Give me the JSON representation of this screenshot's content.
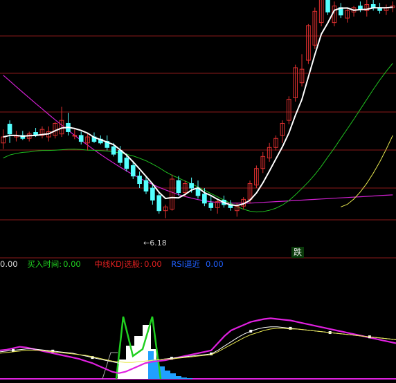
{
  "chart_data": [
    {
      "type": "candlestick",
      "title": "",
      "ylim": [
        4.8,
        8.2
      ],
      "grid": true,
      "annotation": {
        "text": "6.18",
        "arrow": "←"
      },
      "signal_label": "跌",
      "colors": {
        "up": "#e03030",
        "down": "#54ffff",
        "ma_white": "#ffffff",
        "ma_magenta": "#d020d0",
        "ma_green": "#20c020",
        "ma_yellow": "#e8e850",
        "grid": "#8b1a1a"
      },
      "candles": [
        {
          "o": 6.3,
          "h": 6.48,
          "l": 6.22,
          "c": 6.38
        },
        {
          "o": 6.55,
          "h": 6.6,
          "l": 6.3,
          "c": 6.42
        },
        {
          "o": 6.38,
          "h": 6.46,
          "l": 6.32,
          "c": 6.4
        },
        {
          "o": 6.4,
          "h": 6.46,
          "l": 6.34,
          "c": 6.36
        },
        {
          "o": 6.36,
          "h": 6.45,
          "l": 6.32,
          "c": 6.42
        },
        {
          "o": 6.44,
          "h": 6.5,
          "l": 6.38,
          "c": 6.4
        },
        {
          "o": 6.4,
          "h": 6.52,
          "l": 6.36,
          "c": 6.48
        },
        {
          "o": 6.38,
          "h": 6.52,
          "l": 6.32,
          "c": 6.45
        },
        {
          "o": 6.4,
          "h": 6.58,
          "l": 6.36,
          "c": 6.56
        },
        {
          "o": 6.42,
          "h": 6.78,
          "l": 6.38,
          "c": 6.6
        },
        {
          "o": 6.56,
          "h": 6.7,
          "l": 6.4,
          "c": 6.45
        },
        {
          "o": 6.4,
          "h": 6.48,
          "l": 6.35,
          "c": 6.4
        },
        {
          "o": 6.4,
          "h": 6.45,
          "l": 6.28,
          "c": 6.32
        },
        {
          "o": 6.3,
          "h": 6.42,
          "l": 6.2,
          "c": 6.38
        },
        {
          "o": 6.38,
          "h": 6.44,
          "l": 6.3,
          "c": 6.32
        },
        {
          "o": 6.35,
          "h": 6.4,
          "l": 6.28,
          "c": 6.3
        },
        {
          "o": 6.32,
          "h": 6.4,
          "l": 6.2,
          "c": 6.24
        },
        {
          "o": 6.25,
          "h": 6.3,
          "l": 6.12,
          "c": 6.15
        },
        {
          "o": 6.2,
          "h": 6.26,
          "l": 6.0,
          "c": 6.04
        },
        {
          "o": 6.1,
          "h": 6.16,
          "l": 5.92,
          "c": 5.96
        },
        {
          "o": 6.0,
          "h": 6.06,
          "l": 5.82,
          "c": 5.86
        },
        {
          "o": 5.86,
          "h": 5.92,
          "l": 5.7,
          "c": 5.76
        },
        {
          "o": 5.8,
          "h": 5.86,
          "l": 5.62,
          "c": 5.66
        },
        {
          "o": 5.7,
          "h": 5.76,
          "l": 5.48,
          "c": 5.54
        },
        {
          "o": 5.6,
          "h": 5.66,
          "l": 5.36,
          "c": 5.4
        },
        {
          "o": 5.4,
          "h": 5.48,
          "l": 5.3,
          "c": 5.45
        },
        {
          "o": 5.42,
          "h": 5.88,
          "l": 5.4,
          "c": 5.82
        },
        {
          "o": 5.8,
          "h": 5.86,
          "l": 5.6,
          "c": 5.64
        },
        {
          "o": 5.64,
          "h": 5.8,
          "l": 5.58,
          "c": 5.76
        },
        {
          "o": 5.76,
          "h": 5.84,
          "l": 5.64,
          "c": 5.7
        },
        {
          "o": 5.7,
          "h": 5.8,
          "l": 5.56,
          "c": 5.6
        },
        {
          "o": 5.62,
          "h": 5.7,
          "l": 5.46,
          "c": 5.5
        },
        {
          "o": 5.5,
          "h": 5.6,
          "l": 5.4,
          "c": 5.44
        },
        {
          "o": 5.44,
          "h": 5.56,
          "l": 5.36,
          "c": 5.52
        },
        {
          "o": 5.54,
          "h": 5.6,
          "l": 5.44,
          "c": 5.48
        },
        {
          "o": 5.48,
          "h": 5.54,
          "l": 5.4,
          "c": 5.44
        },
        {
          "o": 5.4,
          "h": 5.5,
          "l": 5.32,
          "c": 5.46
        },
        {
          "o": 5.46,
          "h": 5.58,
          "l": 5.42,
          "c": 5.55
        },
        {
          "o": 5.55,
          "h": 5.8,
          "l": 5.5,
          "c": 5.76
        },
        {
          "o": 5.74,
          "h": 6.0,
          "l": 5.7,
          "c": 5.96
        },
        {
          "o": 5.96,
          "h": 6.18,
          "l": 5.9,
          "c": 6.12
        },
        {
          "o": 6.1,
          "h": 6.3,
          "l": 6.05,
          "c": 6.24
        },
        {
          "o": 6.24,
          "h": 6.4,
          "l": 6.2,
          "c": 6.36
        },
        {
          "o": 6.4,
          "h": 6.6,
          "l": 6.3,
          "c": 6.56
        },
        {
          "o": 6.6,
          "h": 6.92,
          "l": 6.55,
          "c": 6.88
        },
        {
          "o": 6.9,
          "h": 7.34,
          "l": 6.85,
          "c": 7.3
        },
        {
          "o": 7.1,
          "h": 7.48,
          "l": 7.05,
          "c": 7.28
        },
        {
          "o": 7.4,
          "h": 7.88,
          "l": 7.35,
          "c": 7.86
        },
        {
          "o": 7.6,
          "h": 8.1,
          "l": 7.55,
          "c": 8.05
        },
        {
          "o": 7.9,
          "h": 8.3,
          "l": 7.85,
          "c": 8.25
        },
        {
          "o": 8.2,
          "h": 8.24,
          "l": 8.0,
          "c": 8.04
        },
        {
          "o": 7.9,
          "h": 8.18,
          "l": 7.85,
          "c": 8.12
        },
        {
          "o": 8.1,
          "h": 8.16,
          "l": 7.96,
          "c": 8.0
        },
        {
          "o": 7.96,
          "h": 8.1,
          "l": 7.9,
          "c": 8.06
        },
        {
          "o": 8.04,
          "h": 8.12,
          "l": 7.98,
          "c": 8.1
        },
        {
          "o": 8.12,
          "h": 8.18,
          "l": 8.04,
          "c": 8.08
        },
        {
          "o": 8.06,
          "h": 8.2,
          "l": 7.98,
          "c": 8.14
        },
        {
          "o": 8.14,
          "h": 8.22,
          "l": 8.06,
          "c": 8.1
        },
        {
          "o": 8.1,
          "h": 8.16,
          "l": 8.02,
          "c": 8.06
        },
        {
          "o": 8.06,
          "h": 8.14,
          "l": 8.0,
          "c": 8.1
        },
        {
          "o": 8.1,
          "h": 8.18,
          "l": 8.04,
          "c": 8.12
        }
      ]
    },
    {
      "type": "line",
      "title": "",
      "ylim": [
        0,
        100
      ],
      "indicators": [
        {
          "label": "0.00"
        },
        {
          "label": "买入时间:",
          "value": "0.00",
          "color": "#20d020"
        },
        {
          "label": "中线KDJ选股:",
          "value": "0.00",
          "color": "#e02020"
        },
        {
          "label": "RSI逼近",
          "value": "0.00",
          "color": "#2060ff"
        }
      ],
      "colors": {
        "magenta": "#e020e0",
        "white": "#ffffff",
        "yellow": "#e8e850",
        "green": "#20d020",
        "blue": "#20a0ff",
        "white_area": "#ffffff"
      },
      "series": [
        {
          "values": [
            40,
            41,
            43,
            45,
            44,
            42,
            40,
            38,
            36,
            34,
            32,
            30,
            28,
            25,
            22,
            18,
            14,
            10,
            8,
            10,
            14,
            18,
            22,
            24,
            25,
            26,
            28,
            30,
            32,
            34,
            36,
            38,
            40,
            50,
            60,
            68,
            72,
            76,
            80,
            82,
            84,
            85,
            84,
            83,
            82,
            80,
            78,
            76,
            74,
            72,
            70,
            68,
            66,
            64,
            62,
            60,
            58,
            56,
            54,
            52,
            50
          ]
        },
        {
          "values": [
            38,
            39,
            40,
            41,
            42,
            42,
            41,
            40,
            39,
            38,
            37,
            36,
            34,
            32,
            30,
            28,
            26,
            24,
            22,
            20,
            20,
            22,
            24,
            26,
            27,
            28,
            29,
            30,
            31,
            32,
            33,
            34,
            35,
            40,
            46,
            52,
            58,
            63,
            67,
            70,
            72,
            73,
            73,
            72,
            71,
            70,
            69,
            68,
            67,
            66,
            65,
            64,
            63,
            62,
            61,
            60,
            59,
            58,
            57,
            56,
            55
          ]
        },
        {
          "values": [
            36,
            37,
            38,
            39,
            40,
            40,
            40,
            39,
            38,
            37,
            36,
            35,
            34,
            33,
            31,
            29,
            27,
            25,
            24,
            23,
            23,
            24,
            25,
            26,
            27,
            28,
            28,
            29,
            30,
            31,
            32,
            33,
            34,
            38,
            43,
            48,
            53,
            58,
            62,
            65,
            68,
            70,
            71,
            71,
            70,
            70,
            69,
            68,
            67,
            66,
            65,
            64,
            63,
            62,
            61,
            60,
            59,
            58,
            57,
            56,
            55
          ]
        }
      ]
    }
  ]
}
